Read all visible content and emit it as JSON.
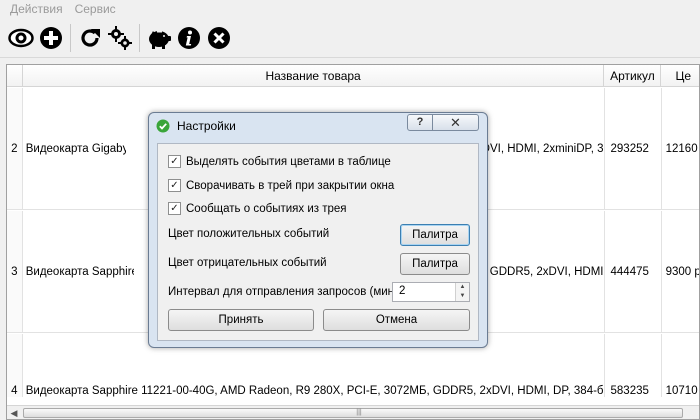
{
  "menu": {
    "items": [
      "Действия",
      "Сервис"
    ]
  },
  "toolbar": {
    "buttons": [
      {
        "name": "eye-icon"
      },
      {
        "name": "add-icon"
      },
      {
        "name": "refresh-icon"
      },
      {
        "name": "settings-gears-icon"
      },
      {
        "name": "piggy-bank-icon"
      },
      {
        "name": "info-icon"
      },
      {
        "name": "close-icon"
      }
    ]
  },
  "table": {
    "headers": [
      "Название товара",
      "Артикул",
      "Це"
    ],
    "rows": [
      {
        "num": "2",
        "name_start": "Видеокарта Gigabyte G",
        "name_end": "DVI, HDMI, 2xminiDP, 3",
        "article": "293252",
        "price": "12160"
      },
      {
        "num": "3",
        "name_start": "Видеокарта Sapphire 1",
        "name_end": "GDDR5, 2xDVI, HDMI",
        "article": "444475",
        "price": "9300 р"
      },
      {
        "num": "4",
        "name_full": "Видеокарта Sapphire 11221-00-40G, AMD Radeon, R9 280X, PCI-E, 3072МБ, GDDR5, 2xDVI, HDMI, DP, 384-би",
        "article": "583235",
        "price": "10710"
      }
    ]
  },
  "dialog": {
    "title": "Настройки",
    "help_label": "?",
    "close_label": "✕",
    "checkboxes": [
      {
        "label": "Выделять события цветами в таблице",
        "checked": true
      },
      {
        "label": "Сворачивать в трей при закрытии окна",
        "checked": true
      },
      {
        "label": "Сообщать о событиях из трея",
        "checked": true
      }
    ],
    "positive_color_label": "Цвет положительных событий",
    "negative_color_label": "Цвет отрицательных событий",
    "palette_button": "Палитра",
    "interval_label": "Интервал для отправления запросов (мин)",
    "interval_value": "2",
    "accept_button": "Принять",
    "cancel_button": "Отмена",
    "check_mark": "✓"
  },
  "colors": {
    "dialog_frame": "#d9e4f1",
    "shield_green": "#3aa53a"
  }
}
